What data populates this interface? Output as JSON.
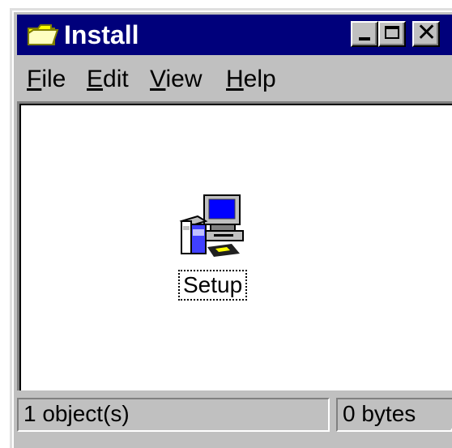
{
  "window": {
    "title": "Install",
    "title_icon": "folder-icon",
    "controls": [
      "minimize",
      "maximize",
      "close"
    ]
  },
  "colors": {
    "titlebar": "#00007b",
    "chrome": "#c0c0c0",
    "content": "#ffffff"
  },
  "menu": {
    "items": [
      {
        "mnemonic": "F",
        "rest": "ile"
      },
      {
        "mnemonic": "E",
        "rest": "dit"
      },
      {
        "mnemonic": "V",
        "rest": "iew"
      },
      {
        "mnemonic": "H",
        "rest": "elp"
      }
    ]
  },
  "content": {
    "items": [
      {
        "label": "Setup",
        "icon": "setup-program-icon",
        "selected": true
      }
    ]
  },
  "status": {
    "objects": "1 object(s)",
    "size": "0 bytes"
  }
}
